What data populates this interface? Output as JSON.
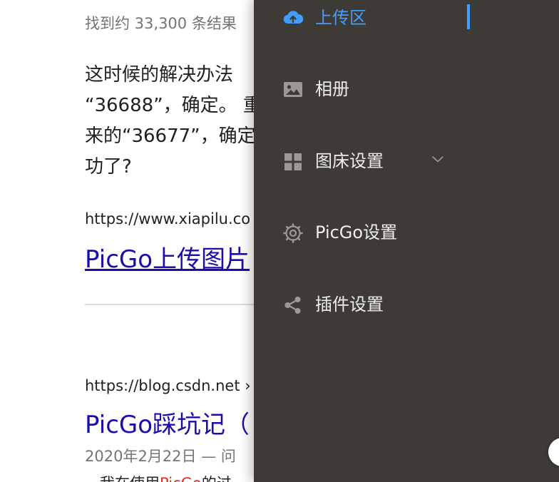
{
  "serp": {
    "result_count": "找到约 33,300 条结果",
    "snippet_lines": [
      "这时候的解决办法",
      "“36688”，确定。 重",
      "来的“36677”，确定",
      "功了?"
    ],
    "results": [
      {
        "cite": "https://www.xiapilu.co",
        "title": "PicGo上传图片"
      },
      {
        "cite": "https://blog.csdn.net ›",
        "title": "PicGo踩坑记（",
        "date": "2020年2月22日 — 问",
        "snippet_prefix": "，我在使用",
        "snippet_em": "PicGo",
        "snippet_suffix": "的过"
      }
    ]
  },
  "sidebar": {
    "items": [
      {
        "label": "上传区",
        "icon": "cloud-upload-icon",
        "active": true
      },
      {
        "label": "相册",
        "icon": "picture-icon"
      },
      {
        "label": "图床设置",
        "icon": "grid-icon",
        "has_submenu": true
      },
      {
        "label": "PicGo设置",
        "icon": "gear-icon"
      },
      {
        "label": "插件设置",
        "icon": "share-icon"
      }
    ]
  },
  "colors": {
    "sidebar_bg": "#3e3b37",
    "accent": "#409eff",
    "menu_text": "#eeeeee",
    "icon_gray": "#9b9994",
    "link": "#1a0dab",
    "snippet_em": "#d93025"
  }
}
